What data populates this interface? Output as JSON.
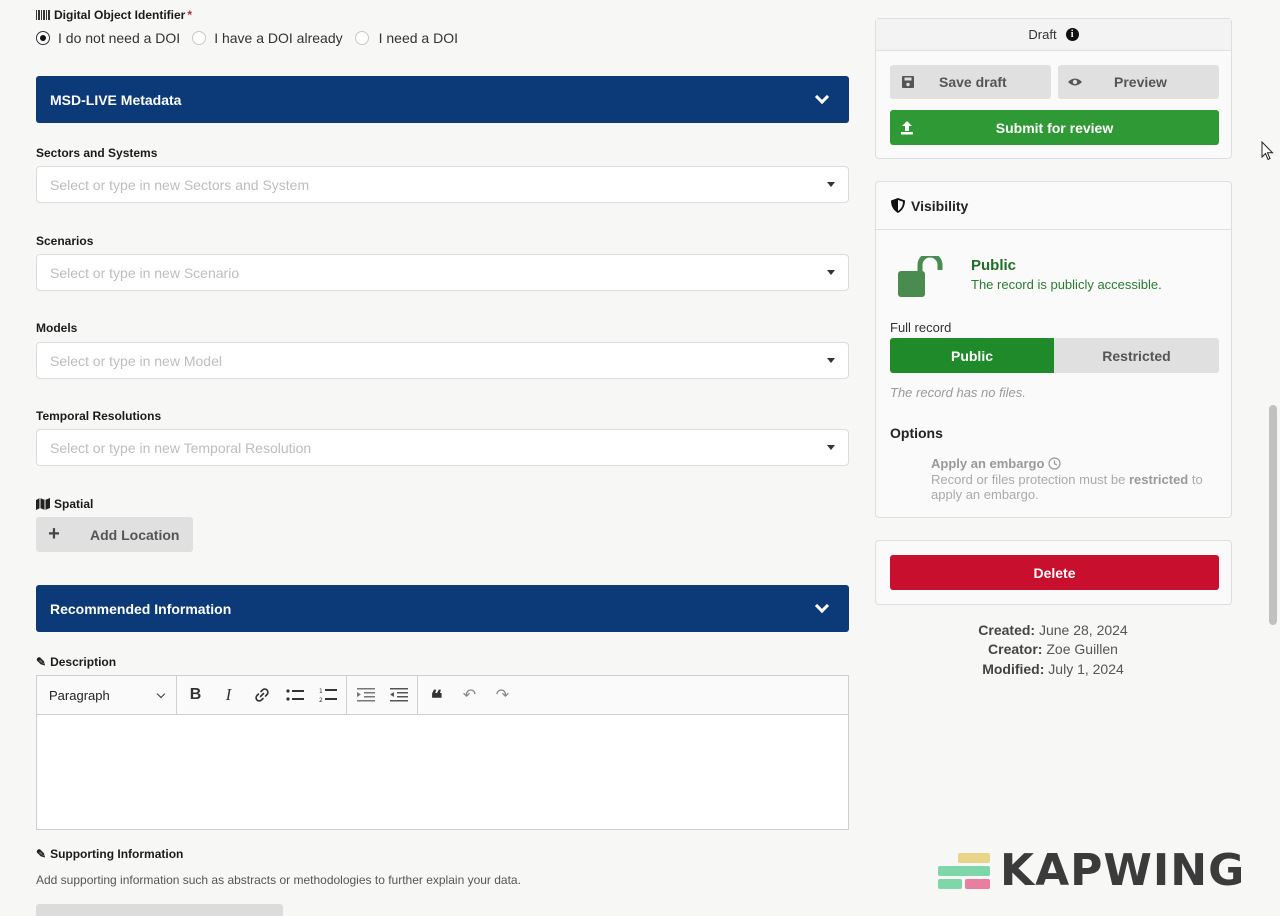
{
  "doi": {
    "label": "Digital Object Identifier",
    "required_mark": "*",
    "options": [
      "I do not need a DOI",
      "I have a DOI already",
      "I need a DOI"
    ],
    "selected": 0
  },
  "msd_section": {
    "title": "MSD-LIVE Metadata",
    "fields": [
      {
        "label": "Sectors and Systems",
        "placeholder": "Select or type in new Sectors and System"
      },
      {
        "label": "Scenarios",
        "placeholder": "Select or type in new Scenario"
      },
      {
        "label": "Models",
        "placeholder": "Select or type in new Model"
      },
      {
        "label": "Temporal Resolutions",
        "placeholder": "Select or type in new Temporal Resolution"
      }
    ],
    "spatial_label": "Spatial",
    "add_location": "Add Location"
  },
  "recommended_section": {
    "title": "Recommended Information",
    "description_label": "Description",
    "editor_format": "Paragraph",
    "supporting_label": "Supporting Information",
    "supporting_help": "Add supporting information such as abstracts or methodologies to further explain your data."
  },
  "sidebar": {
    "status": "Draft",
    "save_draft": "Save draft",
    "preview": "Preview",
    "submit": "Submit for review",
    "visibility": {
      "title": "Visibility",
      "state_title": "Public",
      "state_desc": "The record is publicly accessible.",
      "full_record_label": "Full record",
      "public_btn": "Public",
      "restricted_btn": "Restricted",
      "no_files": "The record has no files.",
      "options_label": "Options",
      "embargo_title": "Apply an embargo",
      "embargo_desc_1": "Record or files protection must be ",
      "embargo_desc_bold": "restricted",
      "embargo_desc_2": " to apply an embargo."
    },
    "delete": "Delete",
    "created_label": "Created:",
    "created_value": "June 28, 2024",
    "creator_label": "Creator:",
    "creator_value": "Zoe Guillen",
    "modified_label": "Modified:",
    "modified_value": "July 1, 2024"
  },
  "watermark": "KAPWING",
  "colors": {
    "accordion": "#0c3a78",
    "submit": "#2f9a35",
    "public_active": "#1f8a2a",
    "delete": "#c8102e",
    "public_text": "#1f6e28"
  }
}
